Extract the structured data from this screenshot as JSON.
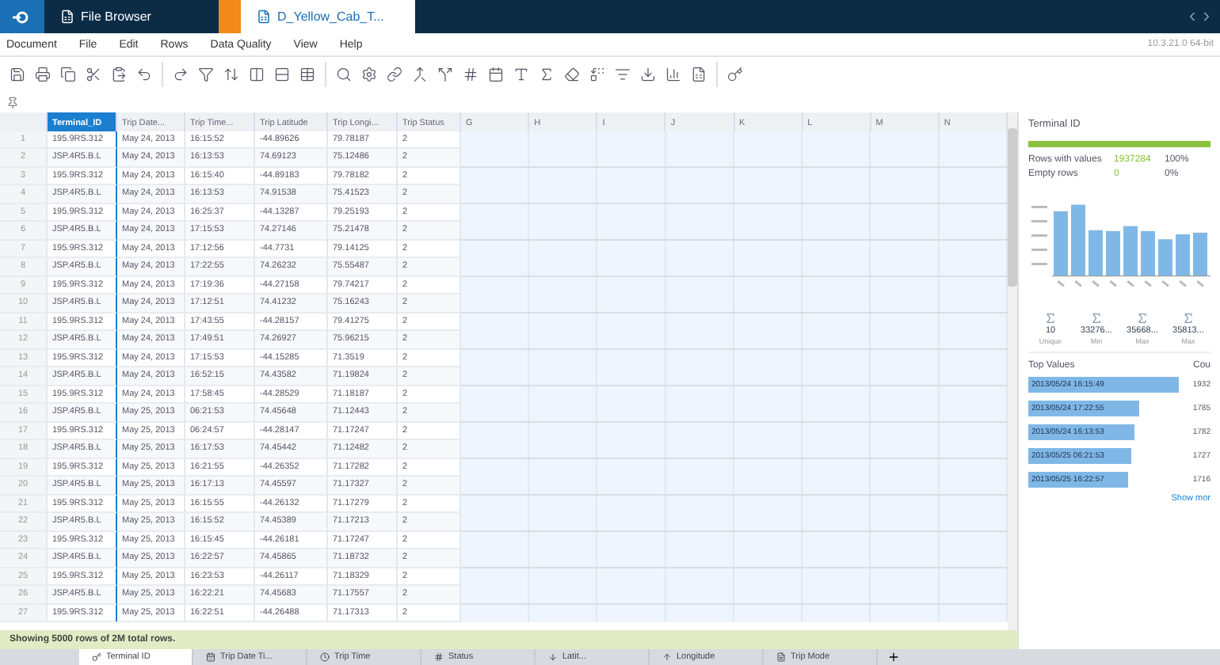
{
  "window_tabs": [
    {
      "label": "File Browser",
      "selected": false
    },
    {
      "label": "D_Yellow_Cab_T...",
      "selected": true
    }
  ],
  "menu": [
    "Document",
    "File",
    "Edit",
    "Rows",
    "Data Quality",
    "View",
    "Help"
  ],
  "version": "10.3.21.0 64-bit",
  "table": {
    "columns": [
      {
        "label": "Terminal_ID",
        "selected": true
      },
      {
        "label": "Trip Date...",
        "selected": false
      },
      {
        "label": "Trip Time...",
        "selected": false
      },
      {
        "label": "Trip Latitude",
        "selected": false
      },
      {
        "label": "Trip Longi...",
        "selected": false
      },
      {
        "label": "Trip Status",
        "selected": false
      },
      {
        "label": "G",
        "selected": false
      },
      {
        "label": "H",
        "selected": false
      },
      {
        "label": "I",
        "selected": false
      },
      {
        "label": "J",
        "selected": false
      },
      {
        "label": "K",
        "selected": false
      },
      {
        "label": "L",
        "selected": false
      },
      {
        "label": "M",
        "selected": false
      },
      {
        "label": "N",
        "selected": false
      }
    ],
    "rows": [
      {
        "number": "1",
        "cells": [
          "195.9RS.312",
          "May 24, 2013",
          "16:15:52",
          "-44.89626",
          "79.78187",
          "2"
        ]
      },
      {
        "number": "2",
        "cells": [
          "JSP.4R5.B.L",
          "May 24, 2013",
          "16:13:53",
          "74.69123",
          "75.12486",
          "2"
        ]
      },
      {
        "number": "3",
        "cells": [
          "195.9RS.312",
          "May 24, 2013",
          "16:15:40",
          "-44.89183",
          "79.78182",
          "2"
        ]
      },
      {
        "number": "4",
        "cells": [
          "JSP.4R5.B.L",
          "May 24, 2013",
          "16:13:53",
          "74.91538",
          "75.41523",
          "2"
        ]
      },
      {
        "number": "5",
        "cells": [
          "195.9RS.312",
          "May 24, 2013",
          "16:25:37",
          "-44.13287",
          "79.25193",
          "2"
        ]
      },
      {
        "number": "6",
        "cells": [
          "JSP.4R5.B.L",
          "May 24, 2013",
          "17:15:53",
          "74.27146",
          "75.21478",
          "2"
        ]
      },
      {
        "number": "7",
        "cells": [
          "195.9RS.312",
          "May 24, 2013",
          "17:12:56",
          "-44.7731",
          "79.14125",
          "2"
        ]
      },
      {
        "number": "8",
        "cells": [
          "JSP.4R5.B.L",
          "May 24, 2013",
          "17:22:55",
          "74.26232",
          "75.55487",
          "2"
        ]
      },
      {
        "number": "9",
        "cells": [
          "195.9RS.312",
          "May 24, 2013",
          "17:19:36",
          "-44.27158",
          "79.74217",
          "2"
        ]
      },
      {
        "number": "10",
        "cells": [
          "JSP.4R5.B.L",
          "May 24, 2013",
          "17:12:51",
          "74.41232",
          "75.16243",
          "2"
        ]
      },
      {
        "number": "11",
        "cells": [
          "195.9RS.312",
          "May 24, 2013",
          "17:43:55",
          "-44.28157",
          "79.41275",
          "2"
        ]
      },
      {
        "number": "12",
        "cells": [
          "JSP.4R5.B.L",
          "May 24, 2013",
          "17:49:51",
          "74.26927",
          "75.96215",
          "2"
        ]
      },
      {
        "number": "13",
        "cells": [
          "195.9RS.312",
          "May 24, 2013",
          "17:15:53",
          "-44.15285",
          "71.3519",
          "2"
        ]
      },
      {
        "number": "14",
        "cells": [
          "JSP.4R5.B.L",
          "May 24, 2013",
          "16:52:15",
          "74.43582",
          "71.19824",
          "2"
        ]
      },
      {
        "number": "15",
        "cells": [
          "195.9RS.312",
          "May 24, 2013",
          "17:58:45",
          "-44.28529",
          "71.18187",
          "2"
        ]
      },
      {
        "number": "16",
        "cells": [
          "JSP.4R5.B.L",
          "May 25, 2013",
          "06:21:53",
          "74.45648",
          "71.12443",
          "2"
        ]
      },
      {
        "number": "17",
        "cells": [
          "195.9RS.312",
          "May 25, 2013",
          "06:24:57",
          "-44.28147",
          "71.17247",
          "2"
        ]
      },
      {
        "number": "18",
        "cells": [
          "JSP.4R5.B.L",
          "May 25, 2013",
          "16:17:53",
          "74.45442",
          "71.12482",
          "2"
        ]
      },
      {
        "number": "19",
        "cells": [
          "195.9RS.312",
          "May 25, 2013",
          "16:21:55",
          "-44.26352",
          "71.17282",
          "2"
        ]
      },
      {
        "number": "20",
        "cells": [
          "JSP.4R5.B.L",
          "May 25, 2013",
          "16:17:13",
          "74.45597",
          "71.17327",
          "2"
        ]
      },
      {
        "number": "21",
        "cells": [
          "195.9RS.312",
          "May 25, 2013",
          "16:15:55",
          "-44.26132",
          "71.17279",
          "2"
        ]
      },
      {
        "number": "22",
        "cells": [
          "JSP.4R5.B.L",
          "May 25, 2013",
          "16:15:52",
          "74.45389",
          "71.17213",
          "2"
        ]
      },
      {
        "number": "23",
        "cells": [
          "195.9RS.312",
          "May 25, 2013",
          "16:15:45",
          "-44.26181",
          "71.17247",
          "2"
        ]
      },
      {
        "number": "24",
        "cells": [
          "JSP.4R5.B.L",
          "May 25, 2013",
          "16:22:57",
          "74.45865",
          "71.18732",
          "2"
        ]
      },
      {
        "number": "25",
        "cells": [
          "195.9RS.312",
          "May 25, 2013",
          "16:23:53",
          "-44.26117",
          "71.18329",
          "2"
        ]
      },
      {
        "number": "26",
        "cells": [
          "JSP.4R5.B.L",
          "May 25, 2013",
          "16:22:21",
          "74.45683",
          "71.17557",
          "2"
        ]
      },
      {
        "number": "27",
        "cells": [
          "195.9RS.312",
          "May 25, 2013",
          "16:22:51",
          "-44.26488",
          "71.17313",
          "2"
        ]
      }
    ]
  },
  "status_bar": "Showing 5000 rows of 2M total rows.",
  "bottom_tabs": [
    {
      "label": "Terminal ID",
      "selected": true
    },
    {
      "label": "Trip Date Ti...",
      "selected": false
    },
    {
      "label": "Trip Time",
      "selected": false
    },
    {
      "label": "Status",
      "selected": false
    },
    {
      "label": "Latit...",
      "selected": false
    },
    {
      "label": "Longitude",
      "selected": false
    },
    {
      "label": "Trip Mode",
      "selected": false
    }
  ],
  "profile": {
    "title": "Terminal ID",
    "level": 1,
    "summary": [
      {
        "label": "Rows with values",
        "value": "1937284",
        "percent": "100%"
      },
      {
        "label": "Empty rows",
        "value": "0",
        "percent": "0%"
      }
    ],
    "stats": [
      {
        "value": "10",
        "label": "Unique"
      },
      {
        "value": "33276...",
        "label": "Min"
      },
      {
        "value": "35668...",
        "label": "Max"
      },
      {
        "value": "35813...",
        "label": "Max"
      }
    ],
    "top_header": "Top Values",
    "count_header": "Cou",
    "top_values": [
      {
        "label": "2013/05/24 16:15:49",
        "count": "1932"
      },
      {
        "label": "2013/05/24 17:22:55",
        "count": "1785"
      },
      {
        "label": "2013/05/24 16:13:53",
        "count": "1782"
      },
      {
        "label": "2013/05/25 06:21:53",
        "count": "1727"
      },
      {
        "label": "2013/05/25 16:22:57",
        "count": "1716"
      }
    ],
    "more": "Show mor"
  }
}
